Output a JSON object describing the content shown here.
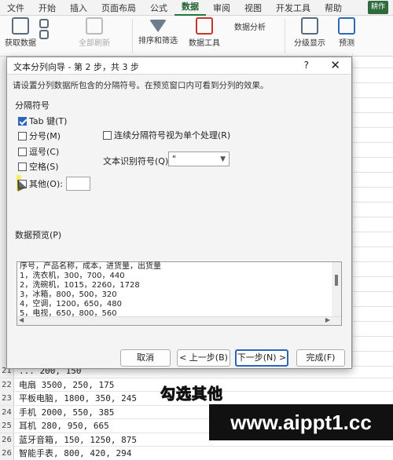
{
  "ribbon": {
    "tabs": [
      "文件",
      "开始",
      "插入",
      "页面布局",
      "公式",
      "数据",
      "审阅",
      "视图",
      "开发工具",
      "帮助"
    ],
    "active_tab": "数据",
    "extra_badge": "耕作",
    "buttons": {
      "get_data": "获取数据",
      "refresh_all": "全部刷新",
      "sort_filter": "排序和筛选",
      "data_tools": "数据工具",
      "data_analysis": "数据分析",
      "outline": "分级显示",
      "forecast": "预测"
    }
  },
  "dialog": {
    "title": "文本分列向导 - 第 2 步，共 3 步",
    "help": "?",
    "close": "✕",
    "instruction": "请设置分列数据所包含的分隔符号。在预览窗口内可看到分列的效果。",
    "delimiters_label": "分隔符号",
    "delimiters": [
      {
        "label": "Tab 键(T)",
        "checked": true
      },
      {
        "label": "分号(M)",
        "checked": false
      },
      {
        "label": "逗号(C)",
        "checked": false
      },
      {
        "label": "空格(S)",
        "checked": false
      },
      {
        "label": "其他(O):",
        "checked": false
      }
    ],
    "consecutive_label": "连续分隔符号视为单个处理(R)",
    "qualifier_label": "文本识别符号(Q):",
    "qualifier_value": "\"",
    "preview_label": "数据预览(P)",
    "preview_lines": [
      "序号，产品名称，成本，进货量，出货量",
      "1，洗衣机，300，700，440",
      "2，洗碗机，1015，2260，1728",
      "3，冰箱，800，500，320",
      "4，空调，1200，650，480",
      "5，电视，650，800，560"
    ],
    "buttons": {
      "cancel": "取消",
      "back": "< 上一步(B)",
      "next": "下一步(N) >",
      "finish": "完成(F)"
    }
  },
  "sheet_rows": [
    {
      "num": "21",
      "text": "... 200, 150"
    },
    {
      "num": "22",
      "text": "电扇 3500, 250, 175"
    },
    {
      "num": "23",
      "text": "平板电脑, 1800, 350, 245"
    },
    {
      "num": "24",
      "text": "手机 2000, 550, 385"
    },
    {
      "num": "25",
      "text": "耳机 280, 950, 665"
    },
    {
      "num": "26",
      "text": "蓝牙音箱, 150, 1250, 875"
    },
    {
      "num": "26",
      "text": "智能手表, 800, 420, 294"
    },
    {
      "num": "27",
      "text": "电动牙刷, 120, 1050, 735"
    }
  ],
  "overlay": {
    "caption": "勾选其他",
    "watermark": "www.aippt1.cc"
  }
}
